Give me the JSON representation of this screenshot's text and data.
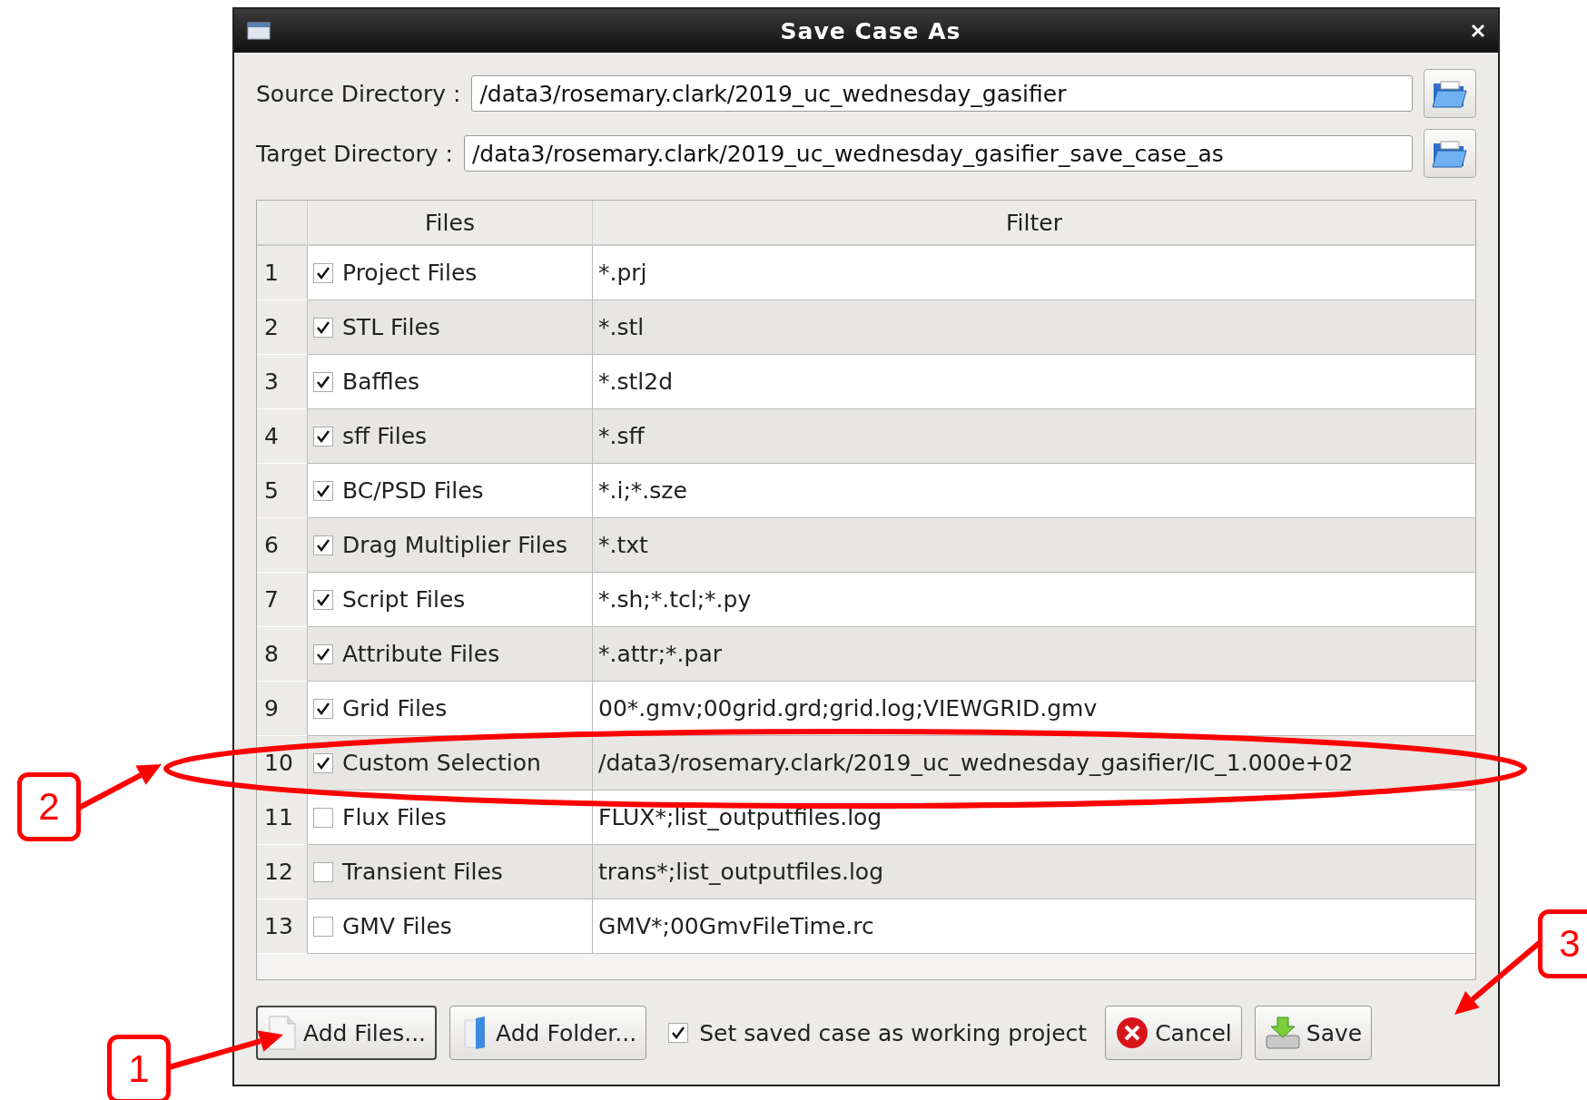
{
  "window": {
    "title": "Save Case As"
  },
  "source": {
    "label": "Source Directory :",
    "value": "/data3/rosemary.clark/2019_uc_wednesday_gasifier"
  },
  "target": {
    "label": "Target Directory :",
    "value": "/data3/rosemary.clark/2019_uc_wednesday_gasifier_save_case_as"
  },
  "table": {
    "columns": [
      "Files",
      "Filter"
    ],
    "rows": [
      {
        "number": "1",
        "checked": true,
        "name": "Project Files",
        "filter": "*.prj"
      },
      {
        "number": "2",
        "checked": true,
        "name": "STL Files",
        "filter": "*.stl"
      },
      {
        "number": "3",
        "checked": true,
        "name": "Baffles",
        "filter": "*.stl2d"
      },
      {
        "number": "4",
        "checked": true,
        "name": "sff Files",
        "filter": "*.sff"
      },
      {
        "number": "5",
        "checked": true,
        "name": "BC/PSD Files",
        "filter": "*.i;*.sze"
      },
      {
        "number": "6",
        "checked": true,
        "name": "Drag Multiplier Files",
        "filter": "*.txt"
      },
      {
        "number": "7",
        "checked": true,
        "name": "Script Files",
        "filter": "*.sh;*.tcl;*.py"
      },
      {
        "number": "8",
        "checked": true,
        "name": "Attribute Files",
        "filter": "*.attr;*.par"
      },
      {
        "number": "9",
        "checked": true,
        "name": "Grid Files",
        "filter": "00*.gmv;00grid.grd;grid.log;VIEWGRID.gmv"
      },
      {
        "number": "10",
        "checked": true,
        "name": "Custom Selection",
        "filter": "/data3/rosemary.clark/2019_uc_wednesday_gasifier/IC_1.000e+02"
      },
      {
        "number": "11",
        "checked": false,
        "name": "Flux Files",
        "filter": "FLUX*;list_outputfiles.log"
      },
      {
        "number": "12",
        "checked": false,
        "name": "Transient Files",
        "filter": "trans*;list_outputfiles.log"
      },
      {
        "number": "13",
        "checked": false,
        "name": "GMV Files",
        "filter": "GMV*;00GmvFileTime.rc"
      }
    ]
  },
  "add_files_button": "Add Files...",
  "add_folder_button": "Add Folder...",
  "working_project": {
    "label": "Set saved case as working project",
    "checked": true
  },
  "cancel_button": "Cancel",
  "save_button": "Save",
  "callouts": [
    {
      "label": "2"
    },
    {
      "label": "1"
    },
    {
      "label": "3"
    }
  ]
}
